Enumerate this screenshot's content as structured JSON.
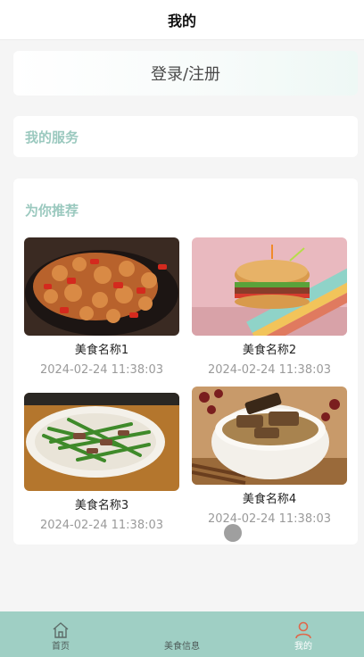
{
  "header": {
    "title": "我的"
  },
  "login": {
    "label": "登录/注册"
  },
  "services": {
    "title": "我的服务"
  },
  "recommend": {
    "title": "为你推荐",
    "items": [
      {
        "name": "美食名称1",
        "time": "2024-02-24 11:38:03",
        "image": "spicy-chicken"
      },
      {
        "name": "美食名称2",
        "time": "2024-02-24 11:38:03",
        "image": "burger"
      },
      {
        "name": "美食名称3",
        "time": "2024-02-24 11:38:03",
        "image": "green-beans-stirfry"
      },
      {
        "name": "美食名称4",
        "time": "2024-02-24 11:38:03",
        "image": "braised-soup"
      }
    ]
  },
  "tabbar": {
    "items": [
      {
        "label": "首页",
        "icon": "home-icon",
        "active": false
      },
      {
        "label": "美食信息",
        "icon": "food-info-icon",
        "active": false
      },
      {
        "label": "我的",
        "icon": "user-icon",
        "active": true
      }
    ]
  },
  "colors": {
    "accent": "#9fcfc4",
    "section_title": "#9bc9bf",
    "active_icon": "#e0674a"
  }
}
